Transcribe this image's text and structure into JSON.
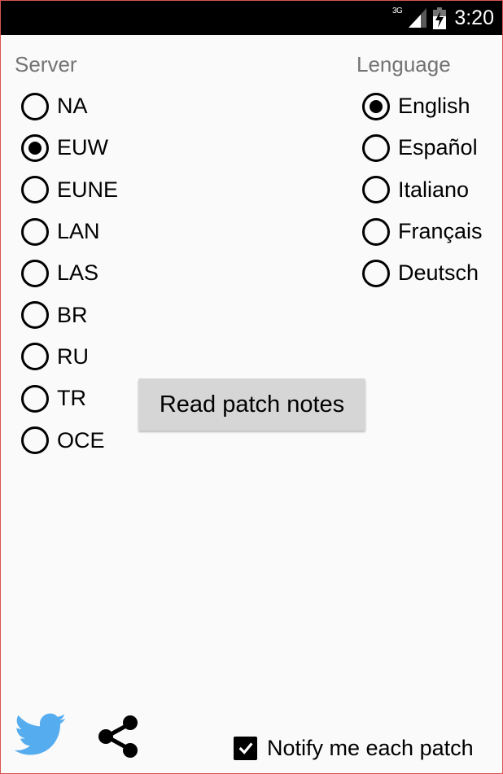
{
  "status_bar": {
    "network": "3G",
    "time": "3:20"
  },
  "server": {
    "label": "Server",
    "options": [
      "NA",
      "EUW",
      "EUNE",
      "LAN",
      "LAS",
      "BR",
      "RU",
      "TR",
      "OCE"
    ],
    "selected": "EUW"
  },
  "language": {
    "label": "Lenguage",
    "options": [
      "English",
      "Español",
      "Italiano",
      "Français",
      "Deutsch"
    ],
    "selected": "English"
  },
  "read_button_label": "Read patch notes",
  "notify": {
    "label": "Notify me each patch",
    "checked": true
  },
  "colors": {
    "twitter": "#55acee",
    "status_bar": "#000000",
    "section_label": "#737373",
    "button_bg": "#d6d6d6"
  }
}
